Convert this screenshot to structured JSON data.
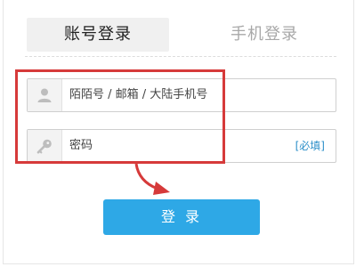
{
  "tabs": {
    "account_login": "账号登录",
    "phone_login": "手机登录"
  },
  "form": {
    "username_field": "陌陌号 / 邮箱 / 大陆手机号",
    "password_field": "密码",
    "password_required": "[必填]"
  },
  "submit": {
    "label": "登 录"
  },
  "icons": {
    "username": "user-icon",
    "password": "key-icon"
  },
  "colors": {
    "button": "#2ea8e6",
    "annotation": "#d63a3a",
    "required_text": "#2c8fc9"
  }
}
